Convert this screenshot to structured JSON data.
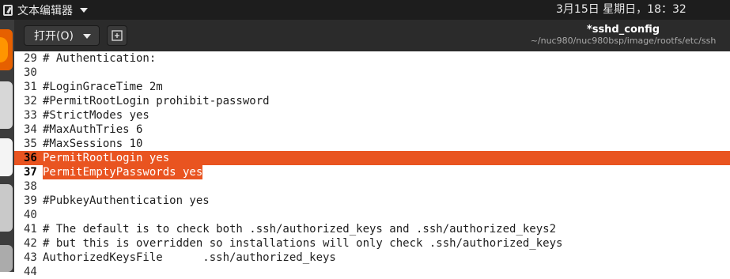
{
  "topbar": {
    "app_name": "文本编辑器",
    "clock": "3月15日 星期日，18：32"
  },
  "headerbar": {
    "open_label": "打开(O)",
    "title": "*sshd_config",
    "path": "~/nuc980/nuc980bsp/image/rootfs/etc/ssh"
  },
  "editor": {
    "highlight_color": "#e95420",
    "lines": [
      {
        "num": "29",
        "text": "# Authentication:"
      },
      {
        "num": "30",
        "text": ""
      },
      {
        "num": "31",
        "text": "#LoginGraceTime 2m"
      },
      {
        "num": "32",
        "text": "#PermitRootLogin prohibit-password"
      },
      {
        "num": "33",
        "text": "#StrictModes yes"
      },
      {
        "num": "34",
        "text": "#MaxAuthTries 6"
      },
      {
        "num": "35",
        "text": "#MaxSessions 10"
      },
      {
        "num": "36",
        "text": "PermitRootLogin yes"
      },
      {
        "num": "37",
        "text": "PermitEmptyPasswords yes"
      },
      {
        "num": "38",
        "text": ""
      },
      {
        "num": "39",
        "text": "#PubkeyAuthentication yes"
      },
      {
        "num": "40",
        "text": ""
      },
      {
        "num": "41",
        "text": "# The default is to check both .ssh/authorized_keys and .ssh/authorized_keys2"
      },
      {
        "num": "42",
        "text": "# but this is overridden so installations will only check .ssh/authorized_keys"
      },
      {
        "num": "43",
        "text": "AuthorizedKeysFile      .ssh/authorized_keys"
      },
      {
        "num": "44",
        "text": ""
      }
    ]
  }
}
